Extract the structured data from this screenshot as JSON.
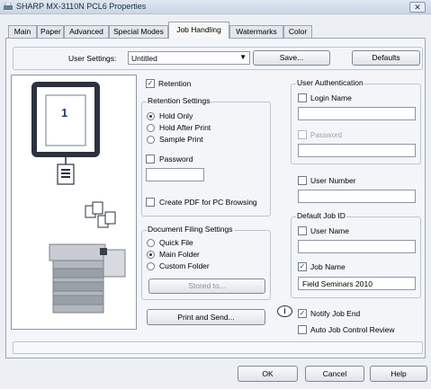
{
  "window": {
    "title": "SHARP MX-3110N PCL6 Properties",
    "close_glyph": "✕"
  },
  "tabs": [
    "Main",
    "Paper",
    "Advanced",
    "Special Modes",
    "Job Handling",
    "Watermarks",
    "Color"
  ],
  "active_tab": "Job Handling",
  "user_settings": {
    "label": "User Settings:",
    "value": "Untitled",
    "save_label": "Save...",
    "defaults_label": "Defaults"
  },
  "preview": {
    "page_number": "1"
  },
  "retention": {
    "checkbox_label": "Retention",
    "checked": true,
    "group_title": "Retention Settings",
    "options": [
      "Hold Only",
      "Hold After Print",
      "Sample Print"
    ],
    "selected": "Hold Only",
    "password_label": "Password",
    "create_pdf_label": "Create PDF for PC Browsing"
  },
  "document_filing": {
    "group_title": "Document Filing Settings",
    "options": [
      "Quick File",
      "Main Folder",
      "Custom Folder"
    ],
    "selected": "Main Folder",
    "stored_to_label": "Stored to..."
  },
  "print_send_label": "Print and Send...",
  "user_auth": {
    "group_title": "User Authentication",
    "login_name_label": "Login Name",
    "password_label": "Password",
    "user_number_label": "User Number"
  },
  "default_job_id": {
    "group_title": "Default Job ID",
    "user_name_label": "User Name",
    "job_name_label": "Job Name",
    "job_name_checked": true,
    "job_name_value": "Field Seminars 2010"
  },
  "notify_job_end_label": "Notify Job End",
  "auto_job_control_label": "Auto Job Control Review",
  "footer": {
    "ok_label": "OK",
    "cancel_label": "Cancel",
    "help_label": "Help"
  },
  "colors": {
    "accent": "#1d2d4a",
    "panel": "#f3f5f8",
    "group_border": "#b8c6da"
  }
}
